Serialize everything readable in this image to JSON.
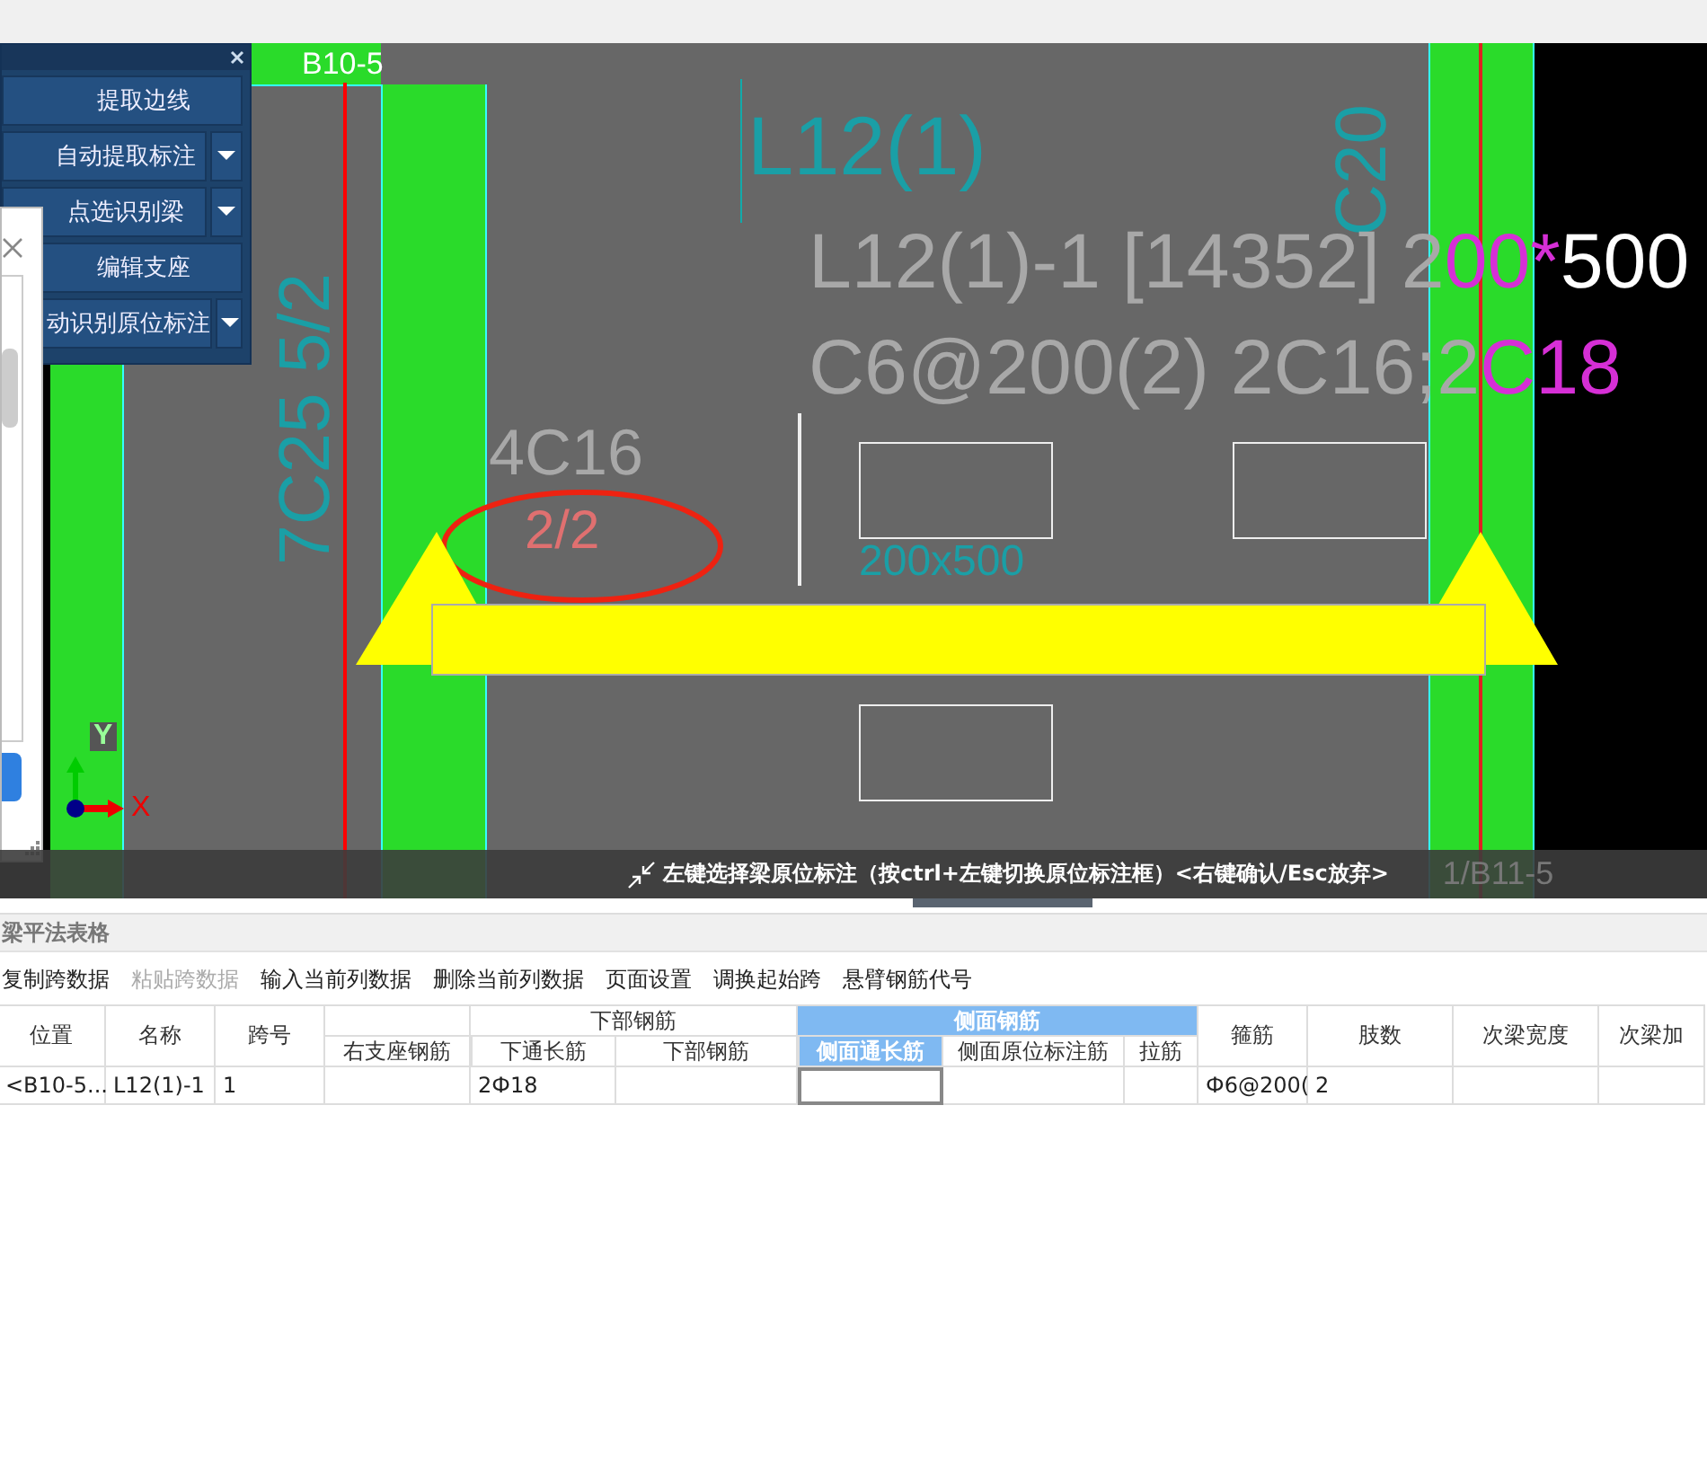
{
  "drawing": {
    "grid_label": "B10-5",
    "beam_name": "L12(1)",
    "vertical_notes": [
      "7C25 5/2",
      "C20"
    ],
    "annotation_lines": [
      [
        {
          "text": "L12(1)-1 [14352] 2",
          "color": "#a8a8a8"
        },
        {
          "text": "00*",
          "color": "#d62fd6"
        },
        {
          "text": "500",
          "color": "#ffffff"
        }
      ],
      [
        {
          "text": "C6@200(2) 2C16;2",
          "color": "#a8a8a8"
        },
        {
          "text": "C18",
          "color": "#d62fd6"
        }
      ]
    ],
    "support_note": "4C16",
    "span_note": "2/2",
    "section_note": "200x500",
    "axis_x": "X",
    "axis_y": "Y"
  },
  "tool_panel": {
    "buttons": [
      {
        "label": "提取边线",
        "dropdown": false
      },
      {
        "label": "自动提取标注",
        "dropdown": true
      },
      {
        "label": "点选识别梁",
        "dropdown": true
      },
      {
        "label": "编辑支座",
        "dropdown": false
      },
      {
        "label": "动识别原位标注",
        "dropdown": true
      }
    ]
  },
  "status_bar": {
    "hint": "左键选择梁原位标注（按ctrl+左键切换原位标注框）<右键确认/Esc放弃>",
    "grid_label": "1/B11-5"
  },
  "table_panel": {
    "title": "梁平法表格",
    "toolbar": [
      {
        "label": "复制跨数据",
        "disabled": false
      },
      {
        "label": "粘贴跨数据",
        "disabled": true
      },
      {
        "label": "输入当前列数据",
        "disabled": false
      },
      {
        "label": "删除当前列数据",
        "disabled": false
      },
      {
        "label": "页面设置",
        "disabled": false
      },
      {
        "label": "调换起始跨",
        "disabled": false
      },
      {
        "label": "悬臂钢筋代号",
        "disabled": false
      }
    ],
    "groups": [
      {
        "label": "下部钢筋",
        "selected": false
      },
      {
        "label": "侧面钢筋",
        "selected": true
      }
    ],
    "columns": [
      {
        "kind": "single",
        "label": "位置",
        "selected": false
      },
      {
        "kind": "single",
        "label": "名称",
        "selected": false
      },
      {
        "kind": "single",
        "label": "跨号",
        "selected": false
      },
      {
        "kind": "loose",
        "label": "右支座钢筋",
        "selected": false
      },
      {
        "kind": "sub",
        "label": "下通长筋",
        "selected": false,
        "starts_group": true
      },
      {
        "kind": "sub",
        "label": "下部钢筋",
        "selected": false,
        "starts_group": false
      },
      {
        "kind": "sub",
        "label": "侧面通长筋",
        "selected": true,
        "starts_group": true
      },
      {
        "kind": "sub",
        "label": "侧面原位标注筋",
        "selected": false,
        "starts_group": false
      },
      {
        "kind": "sub",
        "label": "拉筋",
        "selected": false,
        "starts_group": false
      },
      {
        "kind": "single",
        "label": "箍筋",
        "selected": false
      },
      {
        "kind": "single",
        "label": "肢数",
        "selected": false
      },
      {
        "kind": "single",
        "label": "次梁宽度",
        "selected": false
      },
      {
        "kind": "single",
        "label": "次梁加",
        "selected": false
      }
    ],
    "rows": [
      {
        "cells": [
          {
            "text": "<B10-5...",
            "selected": false
          },
          {
            "text": "L12(1)-1",
            "selected": false
          },
          {
            "text": "1",
            "selected": false
          },
          {
            "selected": false
          },
          {
            "text": "2Ф18",
            "selected": false
          },
          {
            "selected": false
          },
          {
            "selected": true
          },
          {
            "selected": false
          },
          {
            "selected": false
          },
          {
            "text": "Ф6@200(",
            "selected": false
          },
          {
            "text": "2",
            "selected": false
          },
          {
            "selected": false
          },
          {
            "selected": false
          }
        ]
      }
    ]
  }
}
